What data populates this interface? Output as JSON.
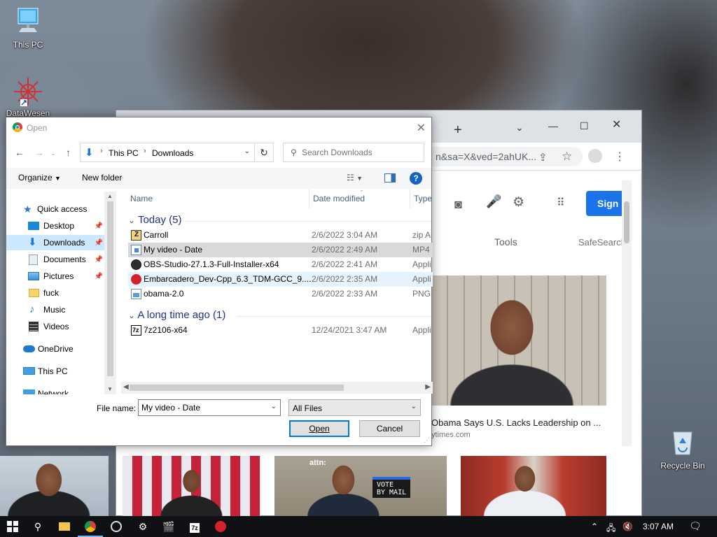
{
  "desktop": {
    "icons": [
      {
        "label": "This PC"
      },
      {
        "label": "DataWesen"
      },
      {
        "label": "Recycle Bin"
      }
    ]
  },
  "chrome": {
    "omnibox_text": "n&sa=X&ved=2ahUK...",
    "sign_in_label": "Sign",
    "tools_label": "Tools",
    "safesearch_label": "SafeSearch",
    "result_caption": "Obama Says U.S. Lacks Leadership on ...",
    "result_source": "ytimes.com",
    "attn_tag": "attn:",
    "vote_text": "VOTE\nBY MAIL"
  },
  "dialog": {
    "title": "Open",
    "breadcrumb": [
      "This PC",
      "Downloads"
    ],
    "search_placeholder": "Search Downloads",
    "organize_label": "Organize",
    "new_folder_label": "New folder",
    "nav_items": [
      {
        "label": "Quick access"
      },
      {
        "label": "Desktop"
      },
      {
        "label": "Downloads"
      },
      {
        "label": "Documents"
      },
      {
        "label": "Pictures"
      },
      {
        "label": "fuck"
      },
      {
        "label": "Music"
      },
      {
        "label": "Videos"
      },
      {
        "label": "OneDrive"
      },
      {
        "label": "This PC"
      },
      {
        "label": "Network"
      }
    ],
    "columns": {
      "name": "Name",
      "date": "Date modified",
      "type": "Type"
    },
    "groups": [
      {
        "label": "Today (5)",
        "files": [
          {
            "name": "Carroll",
            "date": "2/6/2022 3:04 AM",
            "type": "zip A"
          },
          {
            "name": "My video - Date",
            "date": "2/6/2022 2:49 AM",
            "type": "MP4"
          },
          {
            "name": "OBS-Studio-27.1.3-Full-Installer-x64",
            "date": "2/6/2022 2:41 AM",
            "type": "Appli"
          },
          {
            "name": "Embarcadero_Dev-Cpp_6.3_TDM-GCC_9....",
            "date": "2/6/2022 2:35 AM",
            "type": "Appli"
          },
          {
            "name": "obama-2.0",
            "date": "2/6/2022 2:33 AM",
            "type": "PNG"
          }
        ]
      },
      {
        "label": "A long time ago (1)",
        "files": [
          {
            "name": "7z2106-x64",
            "date": "12/24/2021 3:47 AM",
            "type": "Appli"
          }
        ]
      }
    ],
    "file_name_label": "File name:",
    "file_name_value": "My video - Date",
    "file_type_value": "All Files",
    "open_label": "Open",
    "cancel_label": "Cancel"
  },
  "taskbar": {
    "clock": "3:07 AM"
  }
}
